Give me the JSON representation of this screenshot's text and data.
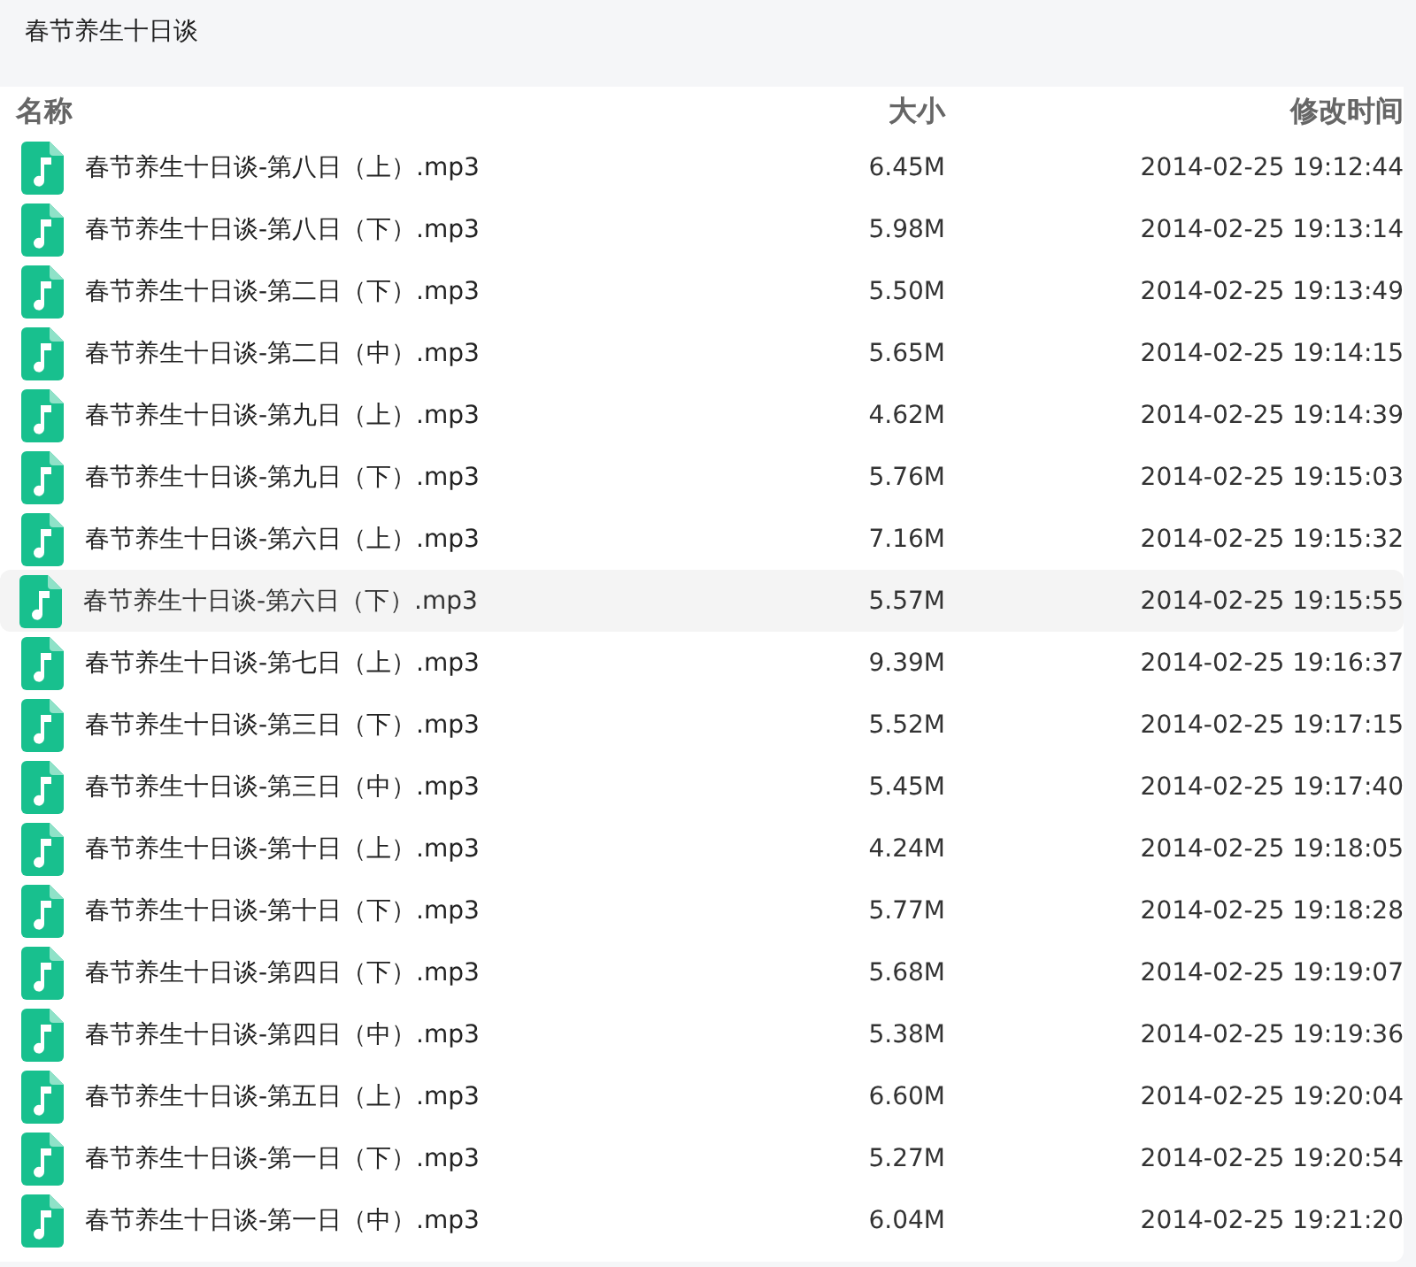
{
  "title": "春节养生十日谈",
  "table": {
    "columns": [
      "名称",
      "大小",
      "修改时间"
    ],
    "rows": [
      {
        "name": "春节养生十日谈-第八日（上）.mp3",
        "size": "6.45M",
        "modified": "2014-02-25 19:12:44",
        "selected": false
      },
      {
        "name": "春节养生十日谈-第八日（下）.mp3",
        "size": "5.98M",
        "modified": "2014-02-25 19:13:14",
        "selected": false
      },
      {
        "name": "春节养生十日谈-第二日（下）.mp3",
        "size": "5.50M",
        "modified": "2014-02-25 19:13:49",
        "selected": false
      },
      {
        "name": "春节养生十日谈-第二日（中）.mp3",
        "size": "5.65M",
        "modified": "2014-02-25 19:14:15",
        "selected": false
      },
      {
        "name": "春节养生十日谈-第九日（上）.mp3",
        "size": "4.62M",
        "modified": "2014-02-25 19:14:39",
        "selected": false
      },
      {
        "name": "春节养生十日谈-第九日（下）.mp3",
        "size": "5.76M",
        "modified": "2014-02-25 19:15:03",
        "selected": false
      },
      {
        "name": "春节养生十日谈-第六日（上）.mp3",
        "size": "7.16M",
        "modified": "2014-02-25 19:15:32",
        "selected": false
      },
      {
        "name": "春节养生十日谈-第六日（下）.mp3",
        "size": "5.57M",
        "modified": "2014-02-25 19:15:55",
        "selected": true
      },
      {
        "name": "春节养生十日谈-第七日（上）.mp3",
        "size": "9.39M",
        "modified": "2014-02-25 19:16:37",
        "selected": false
      },
      {
        "name": "春节养生十日谈-第三日（下）.mp3",
        "size": "5.52M",
        "modified": "2014-02-25 19:17:15",
        "selected": false
      },
      {
        "name": "春节养生十日谈-第三日（中）.mp3",
        "size": "5.45M",
        "modified": "2014-02-25 19:17:40",
        "selected": false
      },
      {
        "name": "春节养生十日谈-第十日（上）.mp3",
        "size": "4.24M",
        "modified": "2014-02-25 19:18:05",
        "selected": false
      },
      {
        "name": "春节养生十日谈-第十日（下）.mp3",
        "size": "5.77M",
        "modified": "2014-02-25 19:18:28",
        "selected": false
      },
      {
        "name": "春节养生十日谈-第四日（下）.mp3",
        "size": "5.68M",
        "modified": "2014-02-25 19:19:07",
        "selected": false
      },
      {
        "name": "春节养生十日谈-第四日（中）.mp3",
        "size": "5.38M",
        "modified": "2014-02-25 19:19:36",
        "selected": false
      },
      {
        "name": "春节养生十日谈-第五日（上）.mp3",
        "size": "6.60M",
        "modified": "2014-02-25 19:20:04",
        "selected": false
      },
      {
        "name": "春节养生十日谈-第一日（下）.mp3",
        "size": "5.27M",
        "modified": "2014-02-25 19:20:54",
        "selected": false
      },
      {
        "name": "春节养生十日谈-第一日（中）.mp3",
        "size": "6.04M",
        "modified": "2014-02-25 19:21:20",
        "selected": false
      }
    ]
  }
}
